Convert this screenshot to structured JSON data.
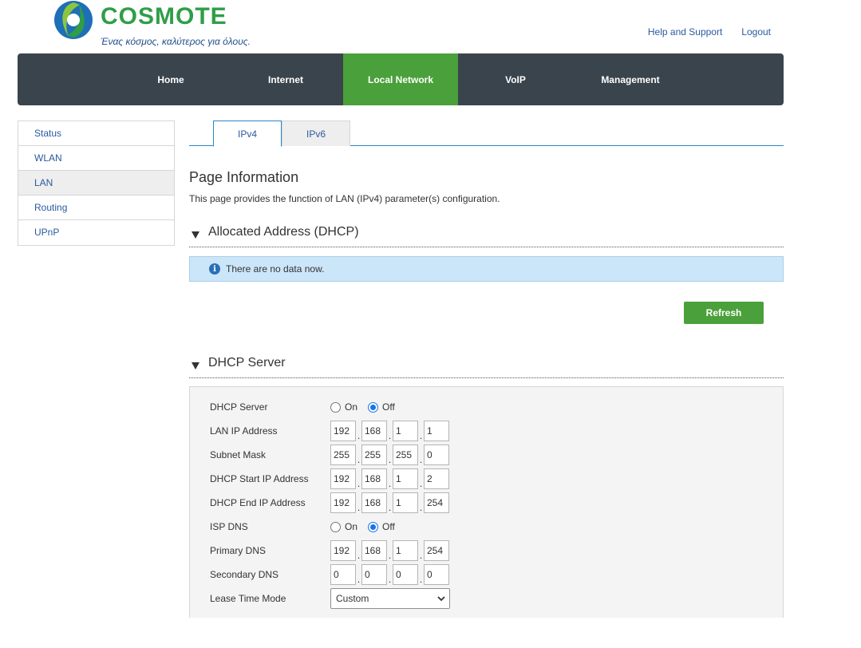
{
  "brand": {
    "name": "COSMOTE",
    "tagline": "Ένας κόσμος, καλύτερος για όλους.",
    "colors": {
      "green": "#4aa03a",
      "nav_bg": "#3a444c",
      "link": "#2a5a9e",
      "info_bg": "#cce6f9"
    }
  },
  "top_links": {
    "help": "Help and Support",
    "logout": "Logout"
  },
  "nav": {
    "items": [
      {
        "label": "Home"
      },
      {
        "label": "Internet"
      },
      {
        "label": "Local Network",
        "active": true
      },
      {
        "label": "VoIP"
      },
      {
        "label": "Management"
      }
    ]
  },
  "sidebar": {
    "items": [
      {
        "label": "Status"
      },
      {
        "label": "WLAN"
      },
      {
        "label": "LAN",
        "active": true
      },
      {
        "label": "Routing"
      },
      {
        "label": "UPnP"
      }
    ]
  },
  "tabs": [
    {
      "label": "IPv4",
      "active": true
    },
    {
      "label": "IPv6"
    }
  ],
  "page": {
    "title": "Page Information",
    "description": "This page provides the function of LAN (IPv4) parameter(s) configuration."
  },
  "allocated": {
    "heading": "Allocated Address (DHCP)",
    "info": "There are no data now.",
    "refresh_label": "Refresh"
  },
  "dhcp": {
    "heading": "DHCP Server",
    "server": {
      "label": "DHCP Server",
      "on": "On",
      "off": "Off",
      "selected": "Off"
    },
    "lan_ip": {
      "label": "LAN IP Address",
      "octets": [
        "192",
        "168",
        "1",
        "1"
      ]
    },
    "subnet": {
      "label": "Subnet Mask",
      "octets": [
        "255",
        "255",
        "255",
        "0"
      ]
    },
    "start_ip": {
      "label": "DHCP Start IP Address",
      "octets": [
        "192",
        "168",
        "1",
        "2"
      ]
    },
    "end_ip": {
      "label": "DHCP End IP Address",
      "octets": [
        "192",
        "168",
        "1",
        "254"
      ]
    },
    "isp_dns": {
      "label": "ISP DNS",
      "on": "On",
      "off": "Off",
      "selected": "Off"
    },
    "primary_dns": {
      "label": "Primary DNS",
      "octets": [
        "192",
        "168",
        "1",
        "254"
      ]
    },
    "secondary_dns": {
      "label": "Secondary DNS",
      "octets": [
        "0",
        "0",
        "0",
        "0"
      ]
    },
    "lease_mode": {
      "label": "Lease Time Mode",
      "value": "Custom"
    }
  },
  "icons": {
    "logo": "cosmote-logo-icon",
    "section_toggle": "triangle-down-icon",
    "info": "info-icon",
    "dropdown": "chevron-down-icon"
  }
}
